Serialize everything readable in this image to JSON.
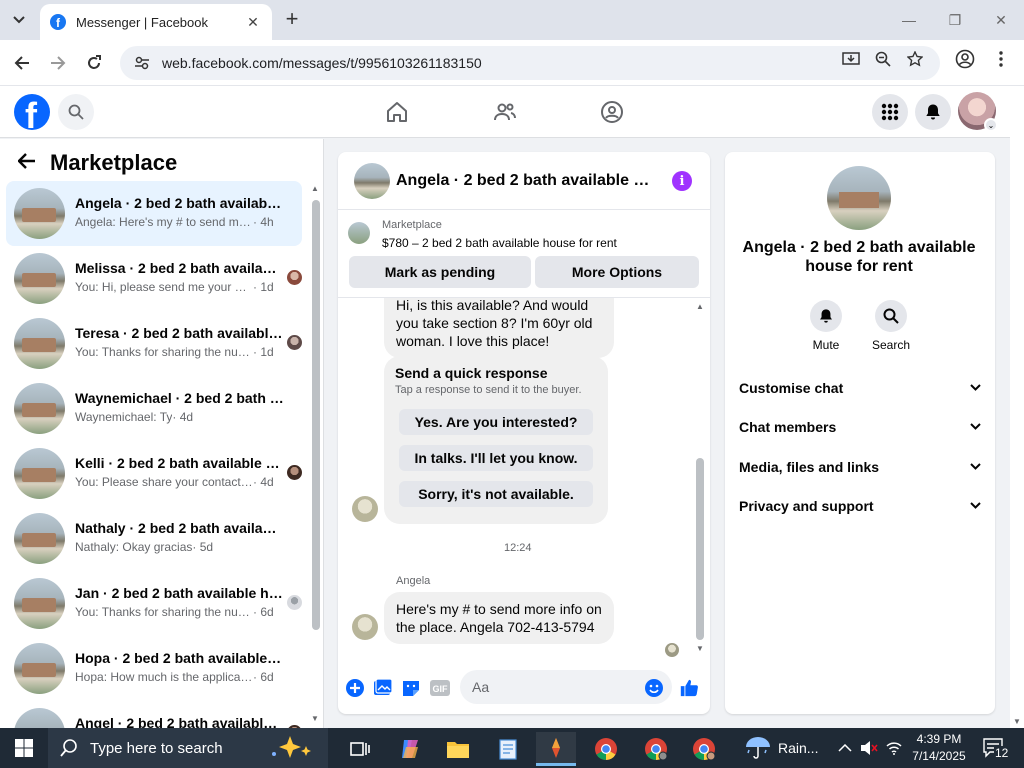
{
  "browser": {
    "tab_title": "Messenger | Facebook",
    "url": "web.facebook.com/messages/t/9956103261183150"
  },
  "sidebar": {
    "title": "Marketplace",
    "conversations": [
      {
        "name": "Angela · 2 bed 2 bath available house for rent",
        "preview": "Angela: Here's my # to send more info on the place.",
        "time": " · 4h"
      },
      {
        "name": "Melissa · 2 bed 2 bath available house for rent",
        "preview": "You: Hi, please send me your number",
        "time": " · 1d"
      },
      {
        "name": "Teresa · 2 bed 2 bath available house for rent",
        "preview": "You: Thanks for sharing the number",
        "time": " · 1d"
      },
      {
        "name": "Waynemichael · 2 bed 2 bath available house for rent",
        "preview": "Waynemichael: Ty",
        "time": " · 4d"
      },
      {
        "name": "Kelli · 2 bed 2 bath available house for rent",
        "preview": "You: Please share your contact number",
        "time": " · 4d"
      },
      {
        "name": "Nathaly · 2 bed 2 bath available house for rent",
        "preview": "Nathaly: Okay gracias",
        "time": " · 5d"
      },
      {
        "name": "Jan · 2 bed 2 bath available house for rent",
        "preview": "You: Thanks for sharing the number",
        "time": " · 6d"
      },
      {
        "name": "Hopa · 2 bed 2 bath available house for rent",
        "preview": "Hopa: How much is the application fee?",
        "time": " · 6d"
      },
      {
        "name": "Angel · 2 bed 2 bath available house for rent",
        "preview": "",
        "time": ""
      }
    ]
  },
  "chat": {
    "title": "Angela · 2 bed 2 bath available house for rent",
    "listing_source": "Marketplace",
    "listing_title": "$780 – 2 bed 2 bath available house for rent",
    "mark_pending": "Mark as pending",
    "more_options": "More Options",
    "message_1": "Hi, is this available? And would you take section 8? I'm 60yr old woman. I love this place!",
    "quick_title": "Send a quick response",
    "quick_sub": "Tap a response to send it to the buyer.",
    "quick_1": "Yes. Are you interested?",
    "quick_2": "In talks. I'll let you know.",
    "quick_3": "Sorry, it's not available.",
    "timestamp": "12:24",
    "sender": "Angela",
    "message_2": "Here's my # to send more info on the place.  Angela 702-413-5794",
    "composer_placeholder": "Aa"
  },
  "info_panel": {
    "title": "Angela · 2 bed 2 bath available house for rent",
    "mute": "Mute",
    "search": "Search",
    "sections": [
      "Customise chat",
      "Chat members",
      "Media, files and links",
      "Privacy and support"
    ]
  },
  "taskbar": {
    "search_placeholder": "Type here to search",
    "weather": "Rain...",
    "time": "4:39 PM",
    "date": "7/14/2025",
    "notifications": "12"
  },
  "colors": {
    "facebook_blue": "#0866ff",
    "messenger_purple": "#a033ff",
    "active_row": "#e7f3ff"
  }
}
